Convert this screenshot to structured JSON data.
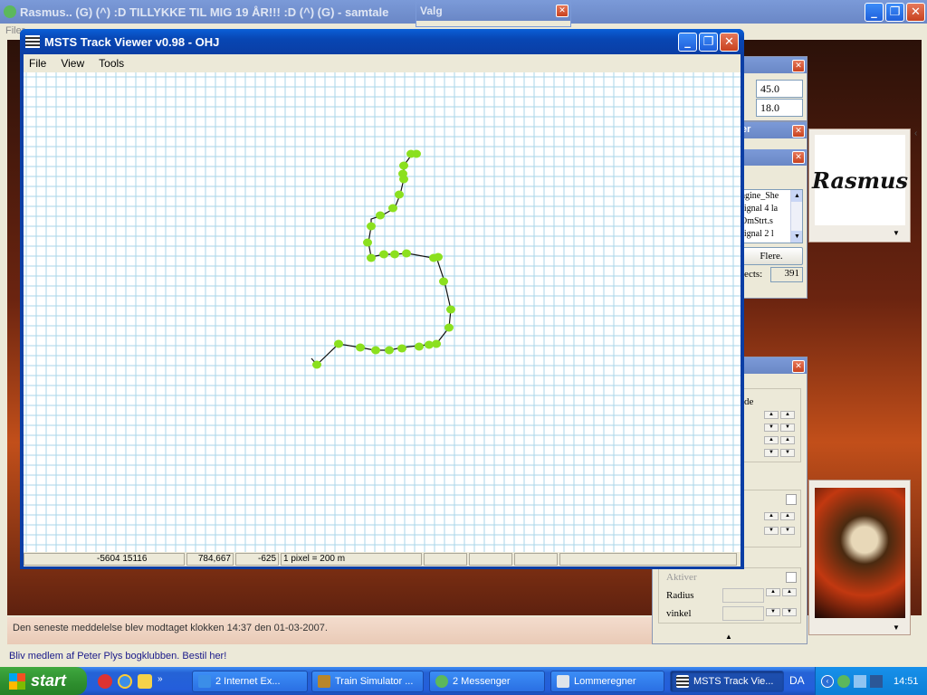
{
  "desktop": {
    "bg_colors": [
      "#1a0e08",
      "#7a2a12",
      "#d4581a"
    ]
  },
  "messenger_window": {
    "title": "Rasmus.. (G) (^) :D TILLYKKE TIL MIG 19 ÅR!!! :D (^) (G) - samtale",
    "menu_first": "Filer",
    "last_message": "Den seneste meddelelse blev modtaget klokken 14:37 den 01-03-2007.",
    "ad_text": "Bliv medlem af Peter Plys bogklubben. Bestil her!",
    "display_picture_text": "Rasmus"
  },
  "valg_window": {
    "title": "Valg"
  },
  "side_panels": {
    "values_panel": {
      "value1": "45.0",
      "value2": "18.0"
    },
    "objects_panel": {
      "title_fragment": "er",
      "list_items": [
        "ngine_She",
        "signal 4 la",
        "OmStrt.s",
        "signal 2 l"
      ],
      "more_button": "Flere.",
      "objects_label": "jects:",
      "objects_count": "391"
    },
    "tool_panel": {
      "label_fragment": "de",
      "activate_label": "Aktiver",
      "radius_label": "Radius",
      "angle_label": "vinkel"
    }
  },
  "main_window": {
    "title": "MSTS Track Viewer v0.98 - OHJ",
    "menu": [
      "File",
      "View",
      "Tools"
    ],
    "status": {
      "coords": "-5604 15116",
      "position": "784,667",
      "height": "-625",
      "scale": "1 pixel = 200 m"
    },
    "grid_color": "#a8d6e8",
    "node_color": "#8be01e"
  },
  "taskbar": {
    "start_label": "start",
    "tasks": [
      {
        "label": "2 Internet Ex..."
      },
      {
        "label": "Train Simulator ..."
      },
      {
        "label": "2 Messenger"
      },
      {
        "label": "Lommeregner"
      },
      {
        "label": "MSTS Track Vie..."
      }
    ],
    "language": "DA",
    "clock": "14:51"
  }
}
